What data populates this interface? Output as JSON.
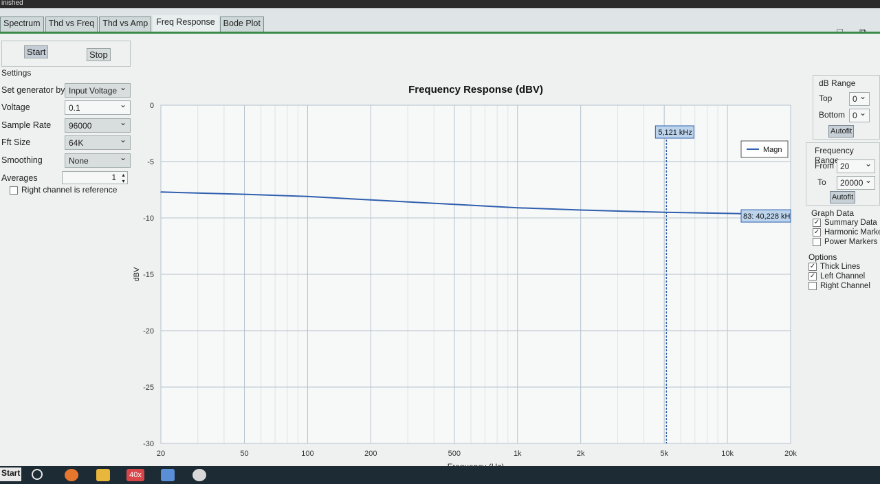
{
  "window": {
    "title": "inished"
  },
  "tabs": [
    "Spectrum",
    "Thd vs Freq",
    "Thd vs Amp",
    "Freq Response",
    "Bode Plot"
  ],
  "window_buttons": [
    "□",
    "⧉"
  ],
  "controls": {
    "start": "Start",
    "stop": "Stop"
  },
  "settings": {
    "legend": "Settings",
    "generator_label": "Set generator by",
    "generator_value": "Input Voltage",
    "voltage_label": "Voltage",
    "voltage_value": "0.1",
    "sample_rate_label": "Sample Rate",
    "sample_rate_value": "96000",
    "fft_label": "Fft Size",
    "fft_value": "64K",
    "smoothing_label": "Smoothing",
    "smoothing_value": "None",
    "averages_label": "Averages",
    "averages_value": "1",
    "ref_label": "Right channel is reference",
    "ref_checked": false
  },
  "right_panel": {
    "db_range": {
      "title": "dB Range",
      "top_label": "Top",
      "top_value": "0",
      "bottom_label": "Bottom",
      "bottom_value": "0",
      "autofit": "Autofit"
    },
    "freq_range": {
      "title": "Frequency Range",
      "from_label": "From",
      "from_value": "20",
      "to_label": "To",
      "to_value": "20000",
      "autofit": "Autofit"
    },
    "graph_data": {
      "title": "Graph Data",
      "items": [
        {
          "label": "Summary Data",
          "checked": true
        },
        {
          "label": "Harmonic Markers",
          "checked": true
        },
        {
          "label": "Power Markers",
          "checked": false
        }
      ]
    },
    "options": {
      "title": "Options",
      "items": [
        {
          "label": "Thick Lines",
          "checked": true
        },
        {
          "label": "Left Channel",
          "checked": true
        },
        {
          "label": "Right Channel",
          "checked": false
        }
      ]
    }
  },
  "chart_data": {
    "type": "line",
    "title": "Frequency Response (dBV)",
    "xlabel": "Frequency (Hz)",
    "ylabel": "dBV",
    "x_scale": "log",
    "xlim": [
      20,
      20000
    ],
    "ylim": [
      -30,
      0
    ],
    "x_ticks": [
      20,
      50,
      100,
      200,
      500,
      1000,
      2000,
      5000,
      10000,
      20000
    ],
    "x_tick_labels": [
      "20",
      "50",
      "100",
      "200",
      "500",
      "1k",
      "2k",
      "5k",
      "10k",
      "20k"
    ],
    "y_ticks": [
      0,
      -5,
      -10,
      -15,
      -20,
      -25,
      -30
    ],
    "y_tick_labels": [
      "0",
      "-5",
      "-10",
      "-15",
      "-20",
      "-25",
      "-30"
    ],
    "grid": true,
    "legend": {
      "entries": [
        "Magn"
      ],
      "position": "top-right"
    },
    "series": [
      {
        "name": "Magn",
        "color": "#2f5fae",
        "x": [
          20,
          50,
          100,
          200,
          500,
          1000,
          2000,
          5000,
          10000,
          20000
        ],
        "y": [
          -7.7,
          -7.9,
          -8.1,
          -8.4,
          -8.8,
          -9.1,
          -9.3,
          -9.5,
          -9.6,
          -9.7
        ]
      }
    ],
    "marker": {
      "frequency": 5121,
      "label": "5,121 kHz",
      "color": "#2f5fae"
    },
    "annotation": {
      "label": "83: 40,228 kH"
    }
  },
  "taskbar": {
    "start": "Start",
    "badge": "40x"
  }
}
